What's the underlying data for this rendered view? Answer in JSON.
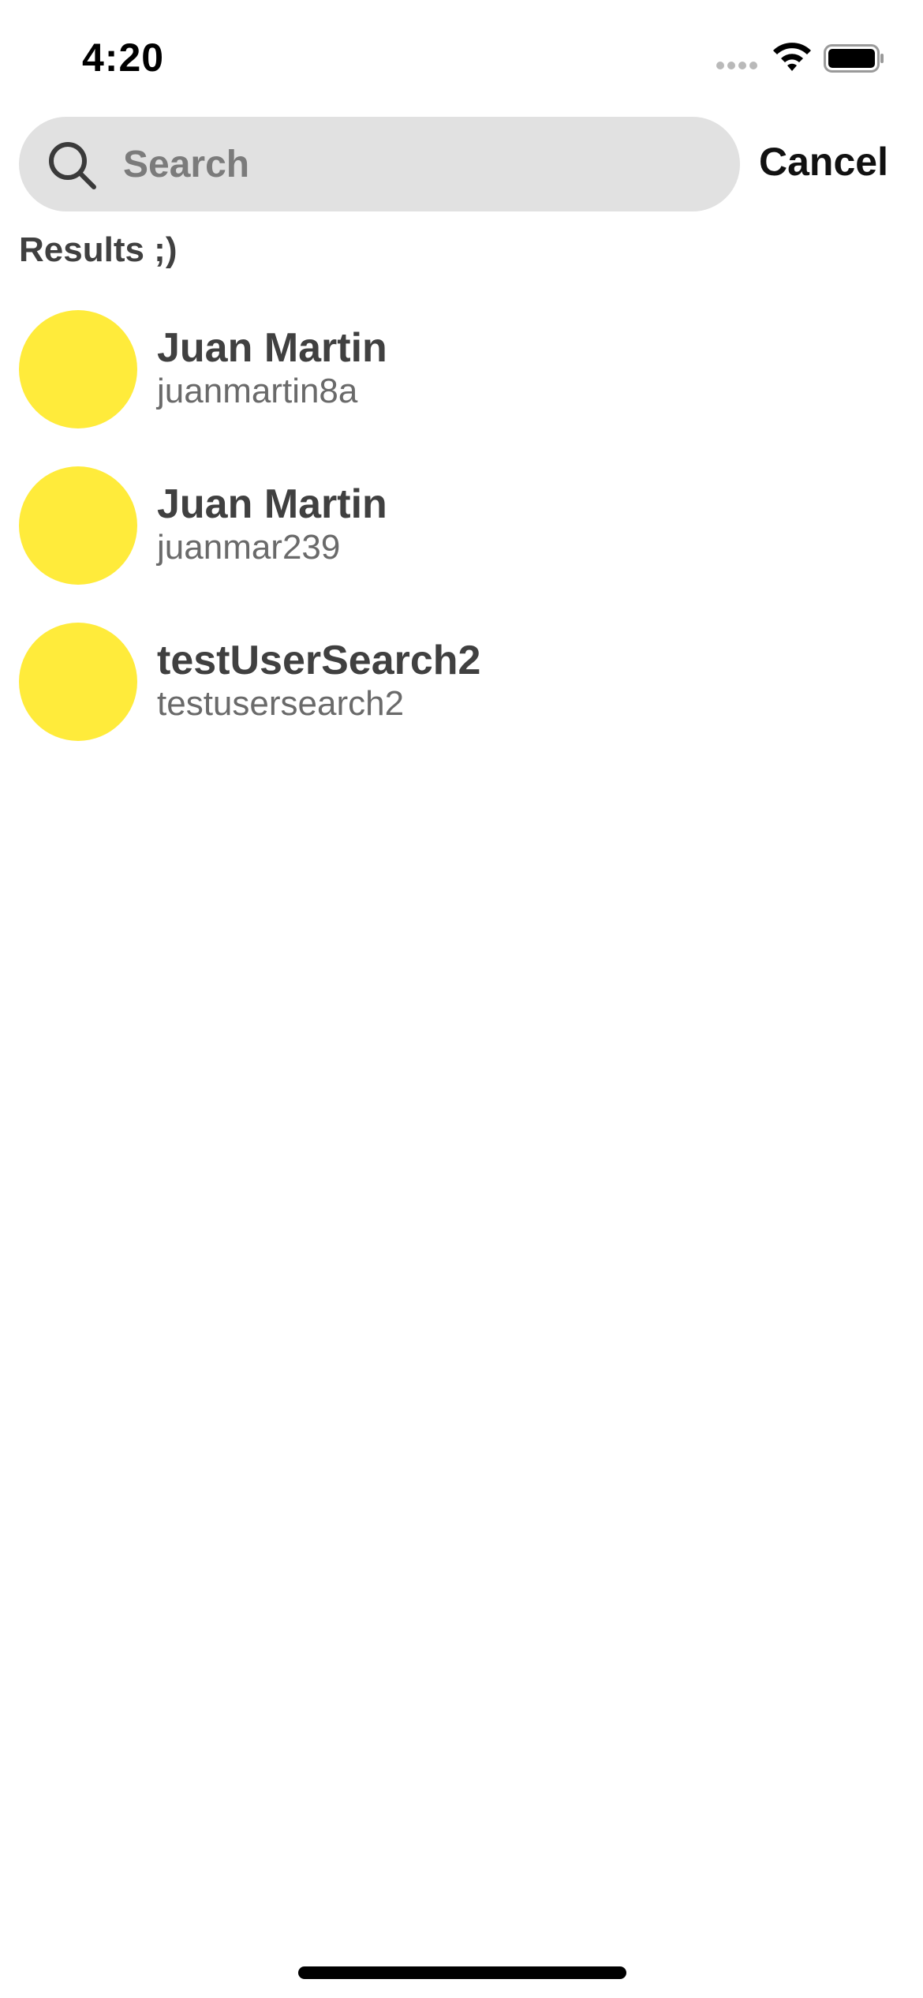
{
  "status_bar": {
    "time": "4:20",
    "icons": [
      "signal-icon",
      "wifi-icon",
      "battery-icon"
    ]
  },
  "search": {
    "placeholder": "Search",
    "value": "",
    "icon": "search-icon",
    "cancel_label": "Cancel"
  },
  "results": {
    "heading": "Results ;)",
    "items": [
      {
        "name": "Juan Martin",
        "username": "juanmartin8a"
      },
      {
        "name": "Juan Martin",
        "username": "juanmar239"
      },
      {
        "name": "testUserSearch2",
        "username": "testusersearch2"
      }
    ]
  },
  "colors": {
    "avatar": "#ffeb3b",
    "search_background": "#e1e1e1",
    "text": "#404040"
  }
}
